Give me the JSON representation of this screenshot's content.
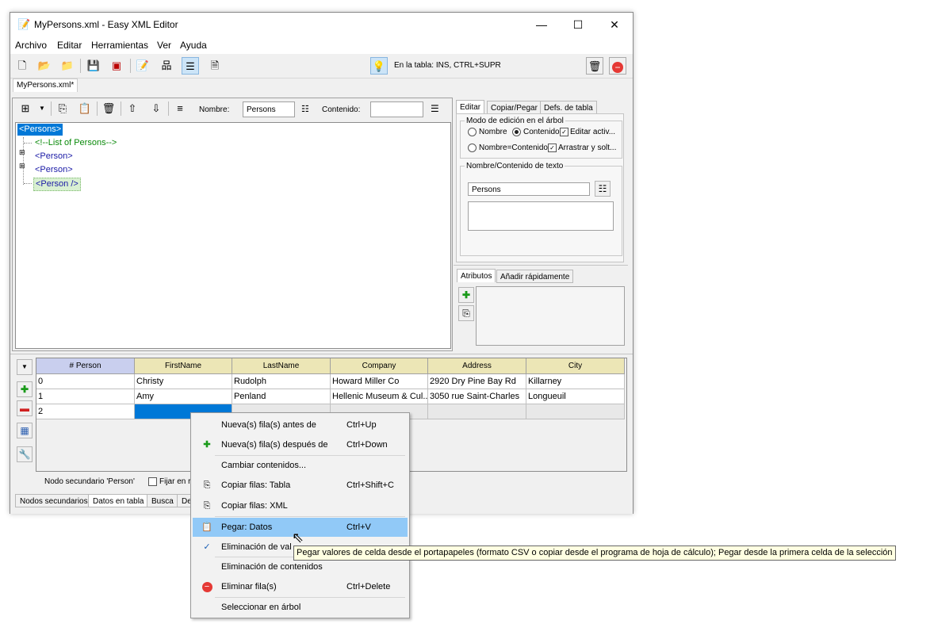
{
  "window": {
    "title": "MyPersons.xml - Easy XML Editor",
    "minimize": "—",
    "maximize": "☐",
    "close": "✕"
  },
  "menu": [
    "Archivo",
    "Editar",
    "Herramientas",
    "Ver",
    "Ayuda"
  ],
  "toolbar": {
    "hint": "En la tabla: INS, CTRL+SUPR"
  },
  "doc_tab": "MyPersons.xml*",
  "tree_toolbar": {
    "name_label": "Nombre:",
    "name_value": "Persons",
    "content_label": "Contenido:",
    "content_value": ""
  },
  "tree": {
    "root": "<Persons>",
    "comment": "<!--List of Persons-->",
    "person1": "<Person>",
    "person2": "<Person>",
    "person3": "<Person />"
  },
  "right_tabs": [
    "Editar",
    "Copiar/Pegar",
    "Defs. de tabla"
  ],
  "edit_mode": {
    "group_label": "Modo de edición en el árbol",
    "opt_nombre": "Nombre",
    "opt_contenido": "Contenido",
    "opt_nombre_contenido": "Nombre=Contenido",
    "chk_editar": "Editar activ...",
    "chk_arrastrar": "Arrastrar y solt..."
  },
  "text_group": {
    "label": "Nombre/Contenido de texto",
    "value": "Persons"
  },
  "attr_tabs": [
    "Atributos",
    "Añadir rápidamente"
  ],
  "grid": {
    "headers": [
      "# Person",
      "FirstName",
      "LastName",
      "Company",
      "Address",
      "City"
    ],
    "rows": [
      [
        "0",
        "Christy",
        "Rudolph",
        "Howard Miller Co",
        "2920 Dry Pine Bay Rd",
        "Killarney"
      ],
      [
        "1",
        "Amy",
        "Penland",
        "Hellenic Museum & Cul...",
        "3050 rue Saint-Charles",
        "Longueuil"
      ],
      [
        "2",
        "",
        "",
        "",
        "",
        ""
      ]
    ]
  },
  "bottom": {
    "node_label": "Nodo secundario 'Person'",
    "fix_label": "Fijar en r",
    "tabs": [
      "Nodos secundarios",
      "Datos en tabla",
      "Busca",
      "De"
    ]
  },
  "context_menu": [
    {
      "label": "Nueva(s) fila(s) antes de",
      "shortcut": "Ctrl+Up",
      "icon": ""
    },
    {
      "label": "Nueva(s) fila(s) después de",
      "shortcut": "Ctrl+Down",
      "icon": "plus-icon"
    },
    {
      "label": "Cambiar contenidos...",
      "shortcut": "",
      "icon": ""
    },
    {
      "label": "Copiar filas: Tabla",
      "shortcut": "Ctrl+Shift+C",
      "icon": "copy-icon"
    },
    {
      "label": "Copiar filas: XML",
      "shortcut": "",
      "icon": "copy-icon"
    },
    {
      "label": "Pegar: Datos",
      "shortcut": "Ctrl+V",
      "icon": "paste-icon"
    },
    {
      "label": "Eliminación de val",
      "shortcut": "",
      "icon": "check-icon"
    },
    {
      "label": "Eliminación de contenidos",
      "shortcut": "",
      "icon": ""
    },
    {
      "label": "Eliminar fila(s)",
      "shortcut": "Ctrl+Delete",
      "icon": "delete-icon"
    },
    {
      "label": "Seleccionar en árbol",
      "shortcut": "",
      "icon": ""
    }
  ],
  "tooltip": "Pegar valores de celda desde el portapapeles (formato CSV o copiar desde el programa de hoja de cálculo); Pegar desde la primera celda de la selección"
}
